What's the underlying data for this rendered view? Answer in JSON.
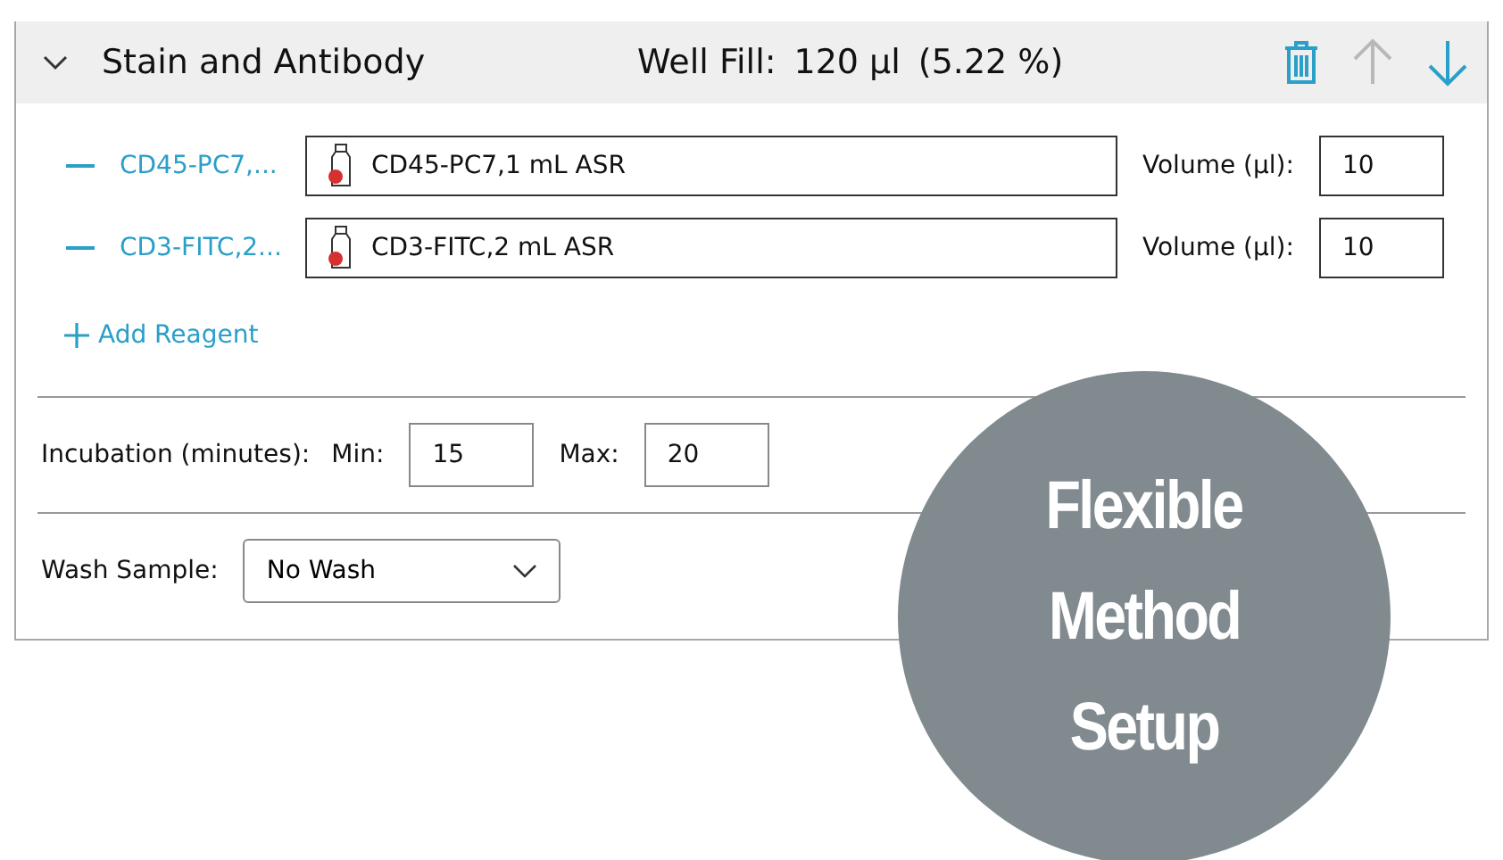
{
  "section": {
    "title": "Stain and Antibody",
    "expanded": true,
    "well_fill_label": "Well Fill:",
    "well_fill_value": "120 µl",
    "well_fill_percent": "(5.22 %)",
    "move_up": {
      "disabled": true
    },
    "move_down": {
      "disabled": false
    }
  },
  "reagents": [
    {
      "short_name": "CD45-PC7,...",
      "reagent": "CD45-PC7,1 mL ASR",
      "volume_label": "Volume (µl):",
      "volume": "10"
    },
    {
      "short_name": "CD3-FITC,2...",
      "reagent": "CD3-FITC,2 mL ASR",
      "volume_label": "Volume (µl):",
      "volume": "10"
    }
  ],
  "add_reagent": "Add Reagent",
  "incubation": {
    "label": "Incubation (minutes):",
    "min_label": "Min:",
    "min": "15",
    "max_label": "Max:",
    "max": "20"
  },
  "wash": {
    "label": "Wash Sample:",
    "value": "No Wash"
  },
  "callout": [
    "Flexible",
    "Method",
    "Setup"
  ]
}
